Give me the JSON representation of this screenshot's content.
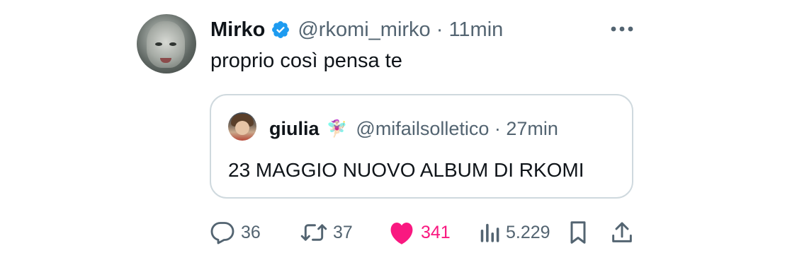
{
  "tweet": {
    "author_name": "Mirko",
    "author_handle": "@rkomi_mirko",
    "time": "11min",
    "text": "proprio così pensa te",
    "handle_time_line": "@rkomi_mirko · 11min"
  },
  "quoted_tweet": {
    "author_name": "giulia",
    "author_handle": "@mifailsolletico",
    "time": "27min",
    "handle_time_line": "@mifailsolletico · 27min",
    "emoji": "🧚🏻‍♀️",
    "text": "23 MAGGIO NUOVO ALBUM DI RKOMI"
  },
  "actions": {
    "replies": "36",
    "reposts": "37",
    "likes": "341",
    "views": "5.229"
  },
  "colors": {
    "text": "#0f1419",
    "secondary": "#536471",
    "verified": "#1d9bf0",
    "like": "#f91880",
    "border": "#cfd9de"
  },
  "icons": [
    "verified-badge-icon",
    "more-icon",
    "reply-icon",
    "repost-icon",
    "like-icon",
    "views-icon",
    "bookmark-icon",
    "share-icon"
  ]
}
